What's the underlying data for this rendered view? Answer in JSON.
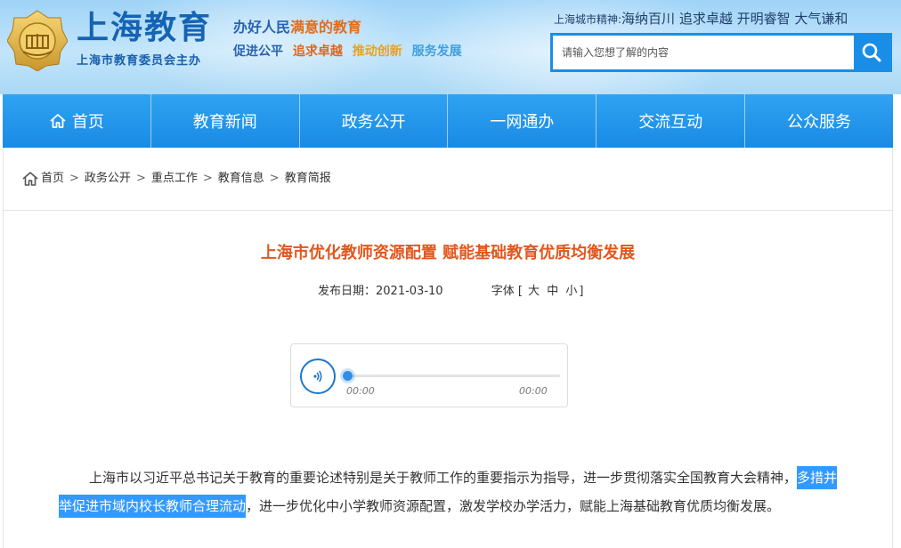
{
  "header": {
    "logo_title": "上海教育",
    "logo_subtitle": "上海市教育委员会主办",
    "slogan_line1": {
      "part1": "办好人民",
      "highlight": "满意的教育"
    },
    "slogan_line2": [
      "促进公平",
      "追求卓越",
      "推动创新",
      "服务发展"
    ],
    "city_spirit_label": "上海城市精神:",
    "city_spirit_text": "海纳百川 追求卓越 开明睿智 大气谦和",
    "search_placeholder": "请输入您想了解的内容"
  },
  "nav": {
    "items": [
      "首页",
      "教育新闻",
      "政务公开",
      "一网通办",
      "交流互动",
      "公众服务"
    ]
  },
  "breadcrumb": [
    "首页",
    "政务公开",
    "重点工作",
    "教育信息",
    "教育简报"
  ],
  "breadcrumb_separator": ">",
  "article": {
    "title": "上海市优化教师资源配置 赋能基础教育优质均衡发展",
    "publish_label": "发布日期：",
    "publish_date": "2021-03-10",
    "font_size_label": "字体 [",
    "font_size_options": [
      "大",
      "中",
      "小"
    ],
    "font_size_close": "]",
    "audio": {
      "current_time": "00:00",
      "duration": "00:00",
      "progress": 0
    },
    "paragraph_before": "上海市以习近平总书记关于教育的重要论述特别是关于教师工作的重要指示为指导，进一步贯彻落实全国教育大会精神，",
    "paragraph_selected": "多措并举促进市域内校长教师合理流动",
    "paragraph_after": "，进一步优化中小学教师资源配置，激发学校办学活力，赋能上海基础教育优质均衡发展。"
  },
  "colors": {
    "nav_blue": "#1a8ae4",
    "title_orange": "#e2571d",
    "brand_blue": "#1563b3",
    "selection_blue": "#3399ff"
  }
}
